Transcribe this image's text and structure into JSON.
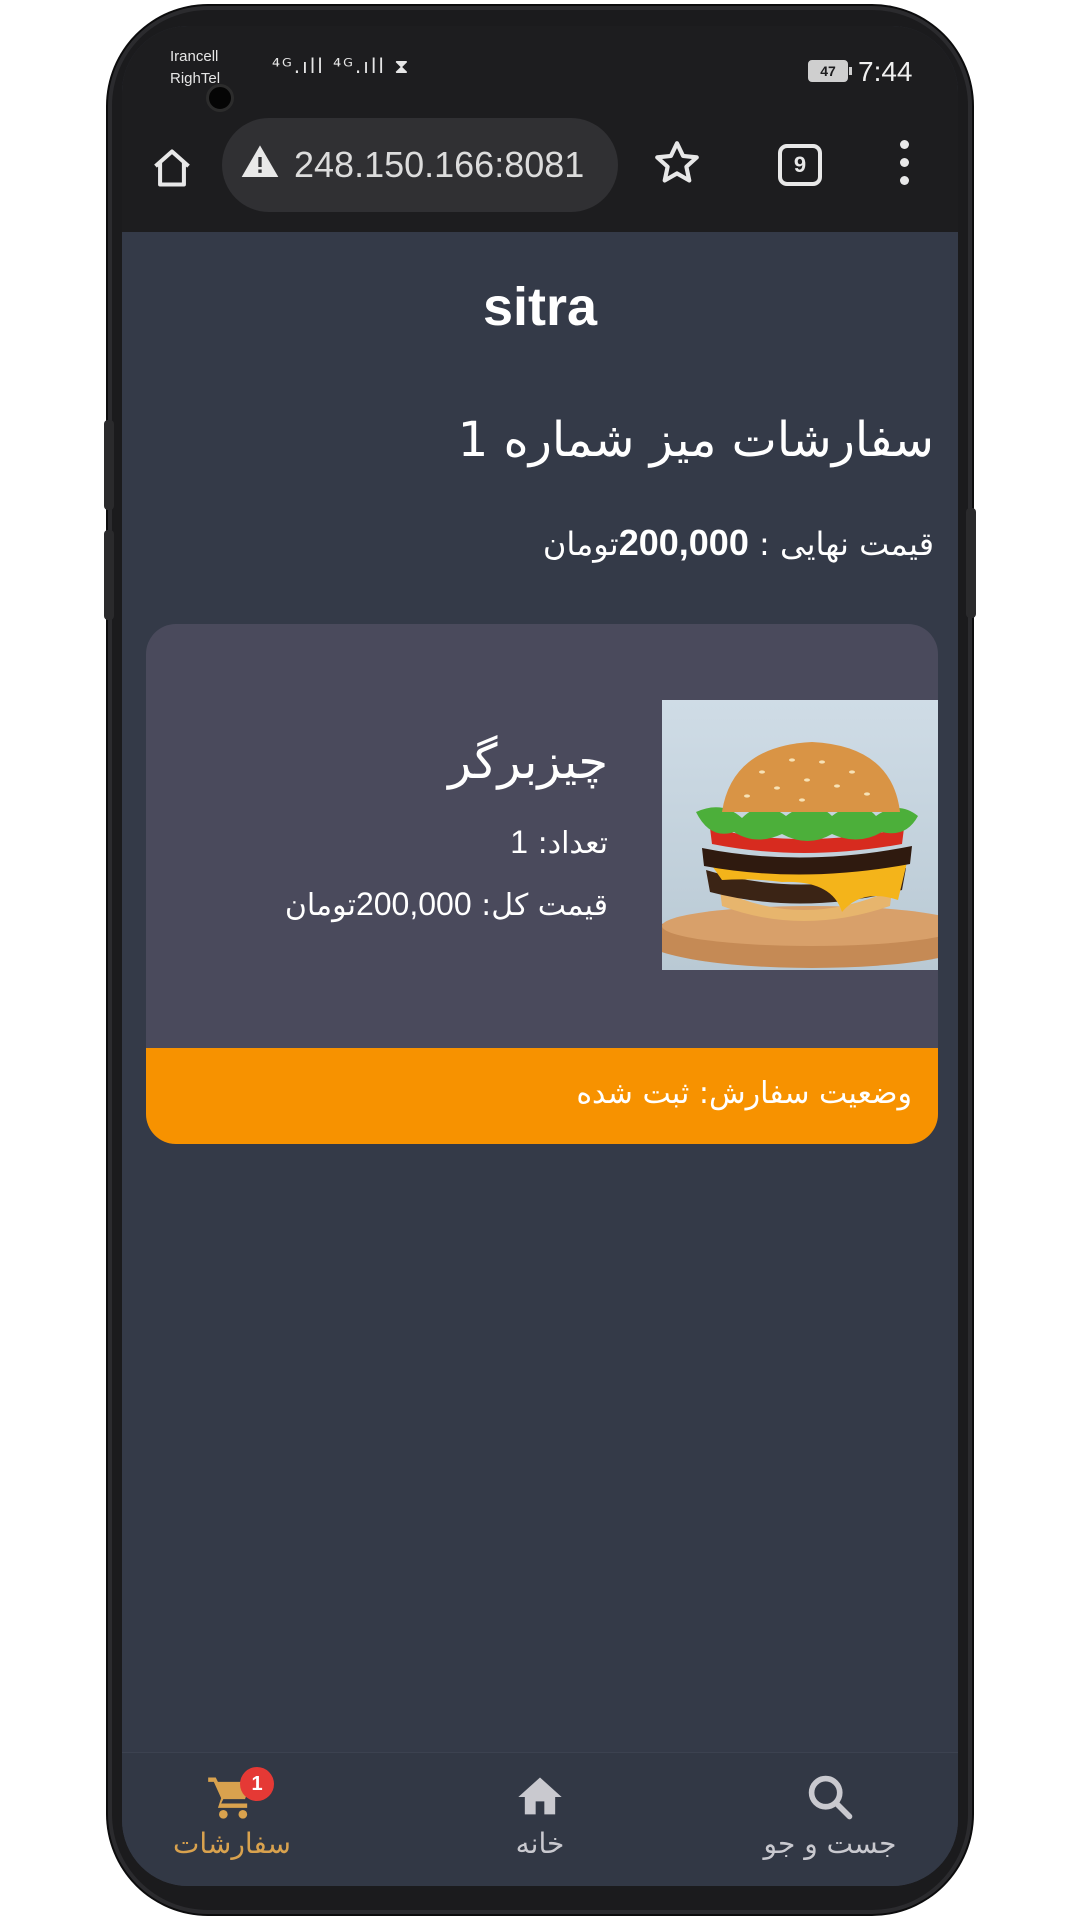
{
  "status_bar": {
    "carrier_1": "Irancell",
    "carrier_2": "RighTel",
    "signal_text": "⁴ᴳ.ıll ⁴ᴳ.ıll ⧗",
    "battery": "47",
    "time": "7:44"
  },
  "browser": {
    "url": "248.150.166:8081",
    "tab_count": "9"
  },
  "page": {
    "brand": "sitra",
    "order_title": "سفارشات میز شماره 1",
    "final_price_label": "قیمت نهایی : ",
    "final_price_value": "200,000",
    "final_price_unit": "تومان"
  },
  "order_item": {
    "name": "چیزبرگر",
    "qty_label": "تعداد: ",
    "qty_value": "1",
    "total_label": "قیمت کل: ",
    "total_value": "200,000",
    "total_unit": "تومان",
    "status_label": "وضعیت سفارش: ",
    "status_value": "ثبت شده"
  },
  "bottom_nav": {
    "orders_label": "سفارشات",
    "orders_badge": "1",
    "home_label": "خانه",
    "search_label": "جست و جو",
    "active_color": "#d9a24e",
    "inactive_color": "#c9c9cf"
  }
}
